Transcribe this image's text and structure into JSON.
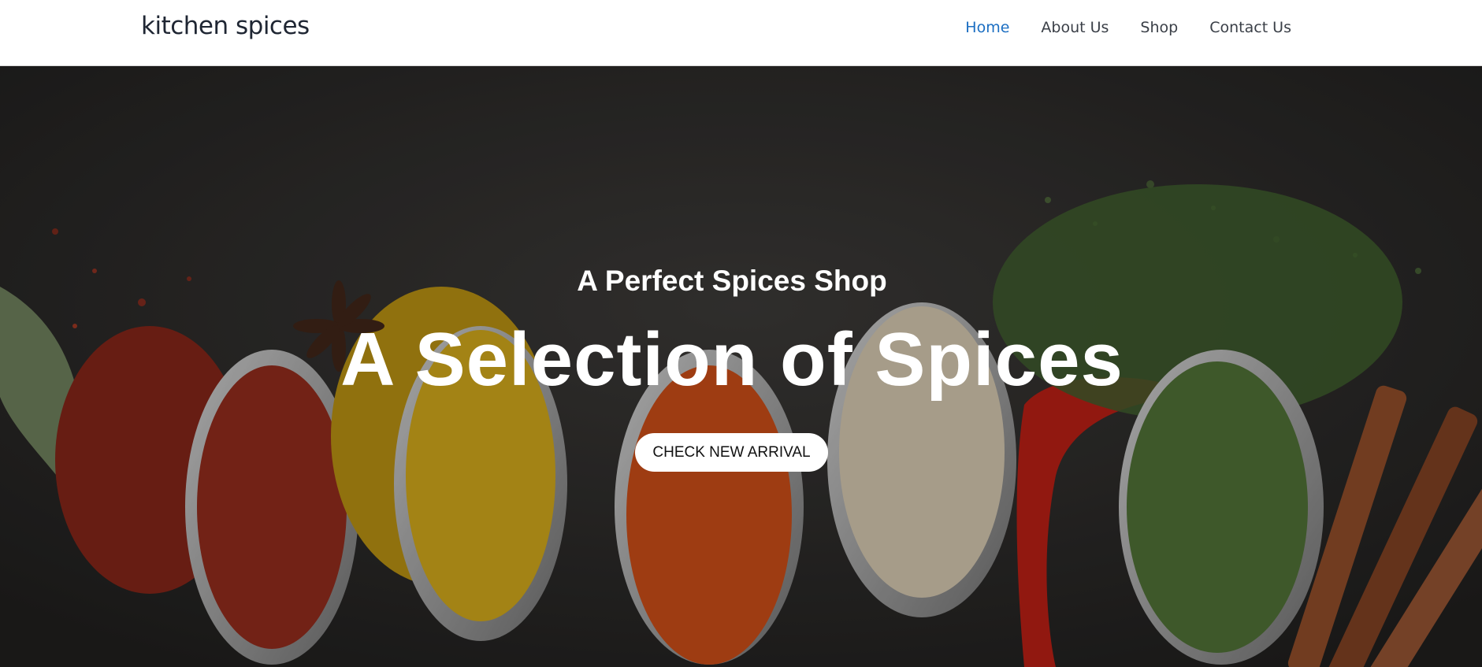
{
  "header": {
    "brand": "kitchen spices",
    "nav": [
      {
        "label": "Home",
        "active": true
      },
      {
        "label": "About Us",
        "active": false
      },
      {
        "label": "Shop",
        "active": false
      },
      {
        "label": "Contact Us",
        "active": false
      }
    ]
  },
  "hero": {
    "subtitle": "A Perfect Spices Shop",
    "title": "A Selection of Spices",
    "cta_label": "CHECK NEW ARRIVAL"
  },
  "colors": {
    "nav_active": "#1b6ec2",
    "nav_text": "#3a3f47",
    "brand_text": "#1f2633",
    "hero_background": "#2c2b2a"
  }
}
